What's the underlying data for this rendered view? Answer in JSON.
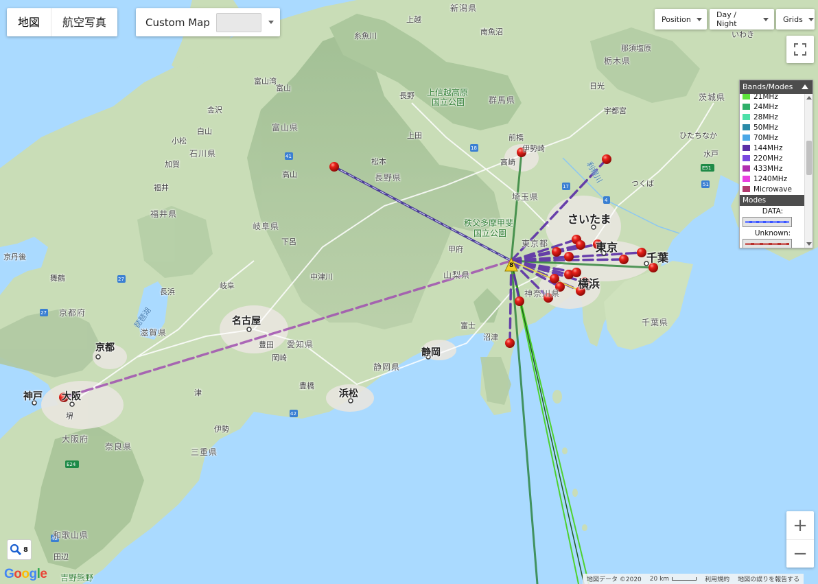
{
  "map_type": {
    "buttons": [
      "地図",
      "航空写真"
    ],
    "active": "地図"
  },
  "custom_map": {
    "label": "Custom Map",
    "value": ""
  },
  "controls": {
    "position": "Position",
    "day_night": "Day / Night",
    "grids": "Grids"
  },
  "legend": {
    "title": "Bands/Modes",
    "bands": [
      {
        "label": "21MHz",
        "color": "#5ee43c"
      },
      {
        "label": "24MHz",
        "color": "#2fb06a"
      },
      {
        "label": "28MHz",
        "color": "#4de0a9"
      },
      {
        "label": "50MHz",
        "color": "#2a8aa8"
      },
      {
        "label": "70MHz",
        "color": "#4aa7e6"
      },
      {
        "label": "144MHz",
        "color": "#5b2ea6"
      },
      {
        "label": "220MHz",
        "color": "#7a48e0"
      },
      {
        "label": "433MHz",
        "color": "#b02eb0"
      },
      {
        "label": "1240MHz",
        "color": "#ea3fe0"
      },
      {
        "label": "Microwave",
        "color": "#b23a6e"
      }
    ],
    "modes_title": "Modes",
    "modes": [
      {
        "label": "DATA:",
        "color": "#3a54ff"
      },
      {
        "label": "Unknown:",
        "color": "#b8302c"
      }
    ]
  },
  "map_labels": {
    "niigata": "新潟県",
    "itoigawa": "糸魚川",
    "minamiuonuma": "南魚沼",
    "joetsu": "上越",
    "nasu": "那須塩原",
    "iwaki": "いわき",
    "tochigi": "栃木県",
    "toyama_city": "富山",
    "toyama_pref": "富山県",
    "kanazawa": "金沢",
    "komatsu": "小松",
    "hakusan": "白山",
    "ishikawa": "石川県",
    "kaga": "加賀",
    "fukui_city": "福井",
    "fukui_pref": "福井県",
    "gifu_pref": "岐阜県",
    "gero": "下呂",
    "nagano_city": "長野",
    "nagano_pref": "長野県",
    "matsumoto": "松本",
    "takayama": "高山",
    "ueda": "上田",
    "park1": "上信越高原",
    "park2": "国立公園",
    "gunma": "群馬県",
    "nikko": "日光",
    "utsunomiya": "宇都宮",
    "ibaraki": "茨城県",
    "hitachinaka": "ひたちなか",
    "mito": "水戸",
    "tsukuba": "つくば",
    "maebashi": "前橋",
    "isesaki": "伊勢崎",
    "takasaki": "高崎",
    "tonegawa": "利根川",
    "saitama_pref": "埼玉県",
    "saitama_city": "さいたま",
    "park3": "秩父多摩甲斐",
    "park4": "国立公園",
    "tokyo_to": "東京都",
    "tokyo": "東京",
    "chiba_city": "千葉",
    "chiba_pref": "千葉県",
    "yokohama": "横浜",
    "kanagawa": "神奈川県",
    "kofu": "甲府",
    "yamanashi": "山梨県",
    "nakatsugawa": "中津川",
    "gifu_city": "岐阜",
    "nagahama": "長浜",
    "biwako": "琵琶湖",
    "shiga": "滋賀県",
    "kyoto_pref": "京都府",
    "kyoto_city": "京都",
    "nagoya": "名古屋",
    "aichi": "愛知県",
    "toyota": "豊田",
    "okazaki": "岡崎",
    "fuji": "富士",
    "numazu": "沼津",
    "shizuoka_city": "静岡",
    "shizuoka_pref": "静岡県",
    "toyohashi": "豊橋",
    "hamamatsu": "浜松",
    "kobe": "神戸",
    "osaka_city": "大阪",
    "sakai": "堺",
    "osaka_pref": "大阪府",
    "nara": "奈良県",
    "tsu": "津",
    "ise": "伊勢",
    "mie": "三重県",
    "wakayama": "和歌山県",
    "tanabe": "田辺",
    "yoshino": "吉野熊野",
    "maizuru": "舞鶴",
    "kyotango": "京丹後",
    "toyama_bay": "富山湾"
  },
  "zoom": {
    "in": "+",
    "out": "−",
    "level": "8"
  },
  "google": "Google",
  "attribution": {
    "data": "地図データ ©2020",
    "scale": "20 km",
    "terms": "利用規約",
    "report": "地図の誤りを報告する"
  },
  "station": {
    "label": "8"
  }
}
